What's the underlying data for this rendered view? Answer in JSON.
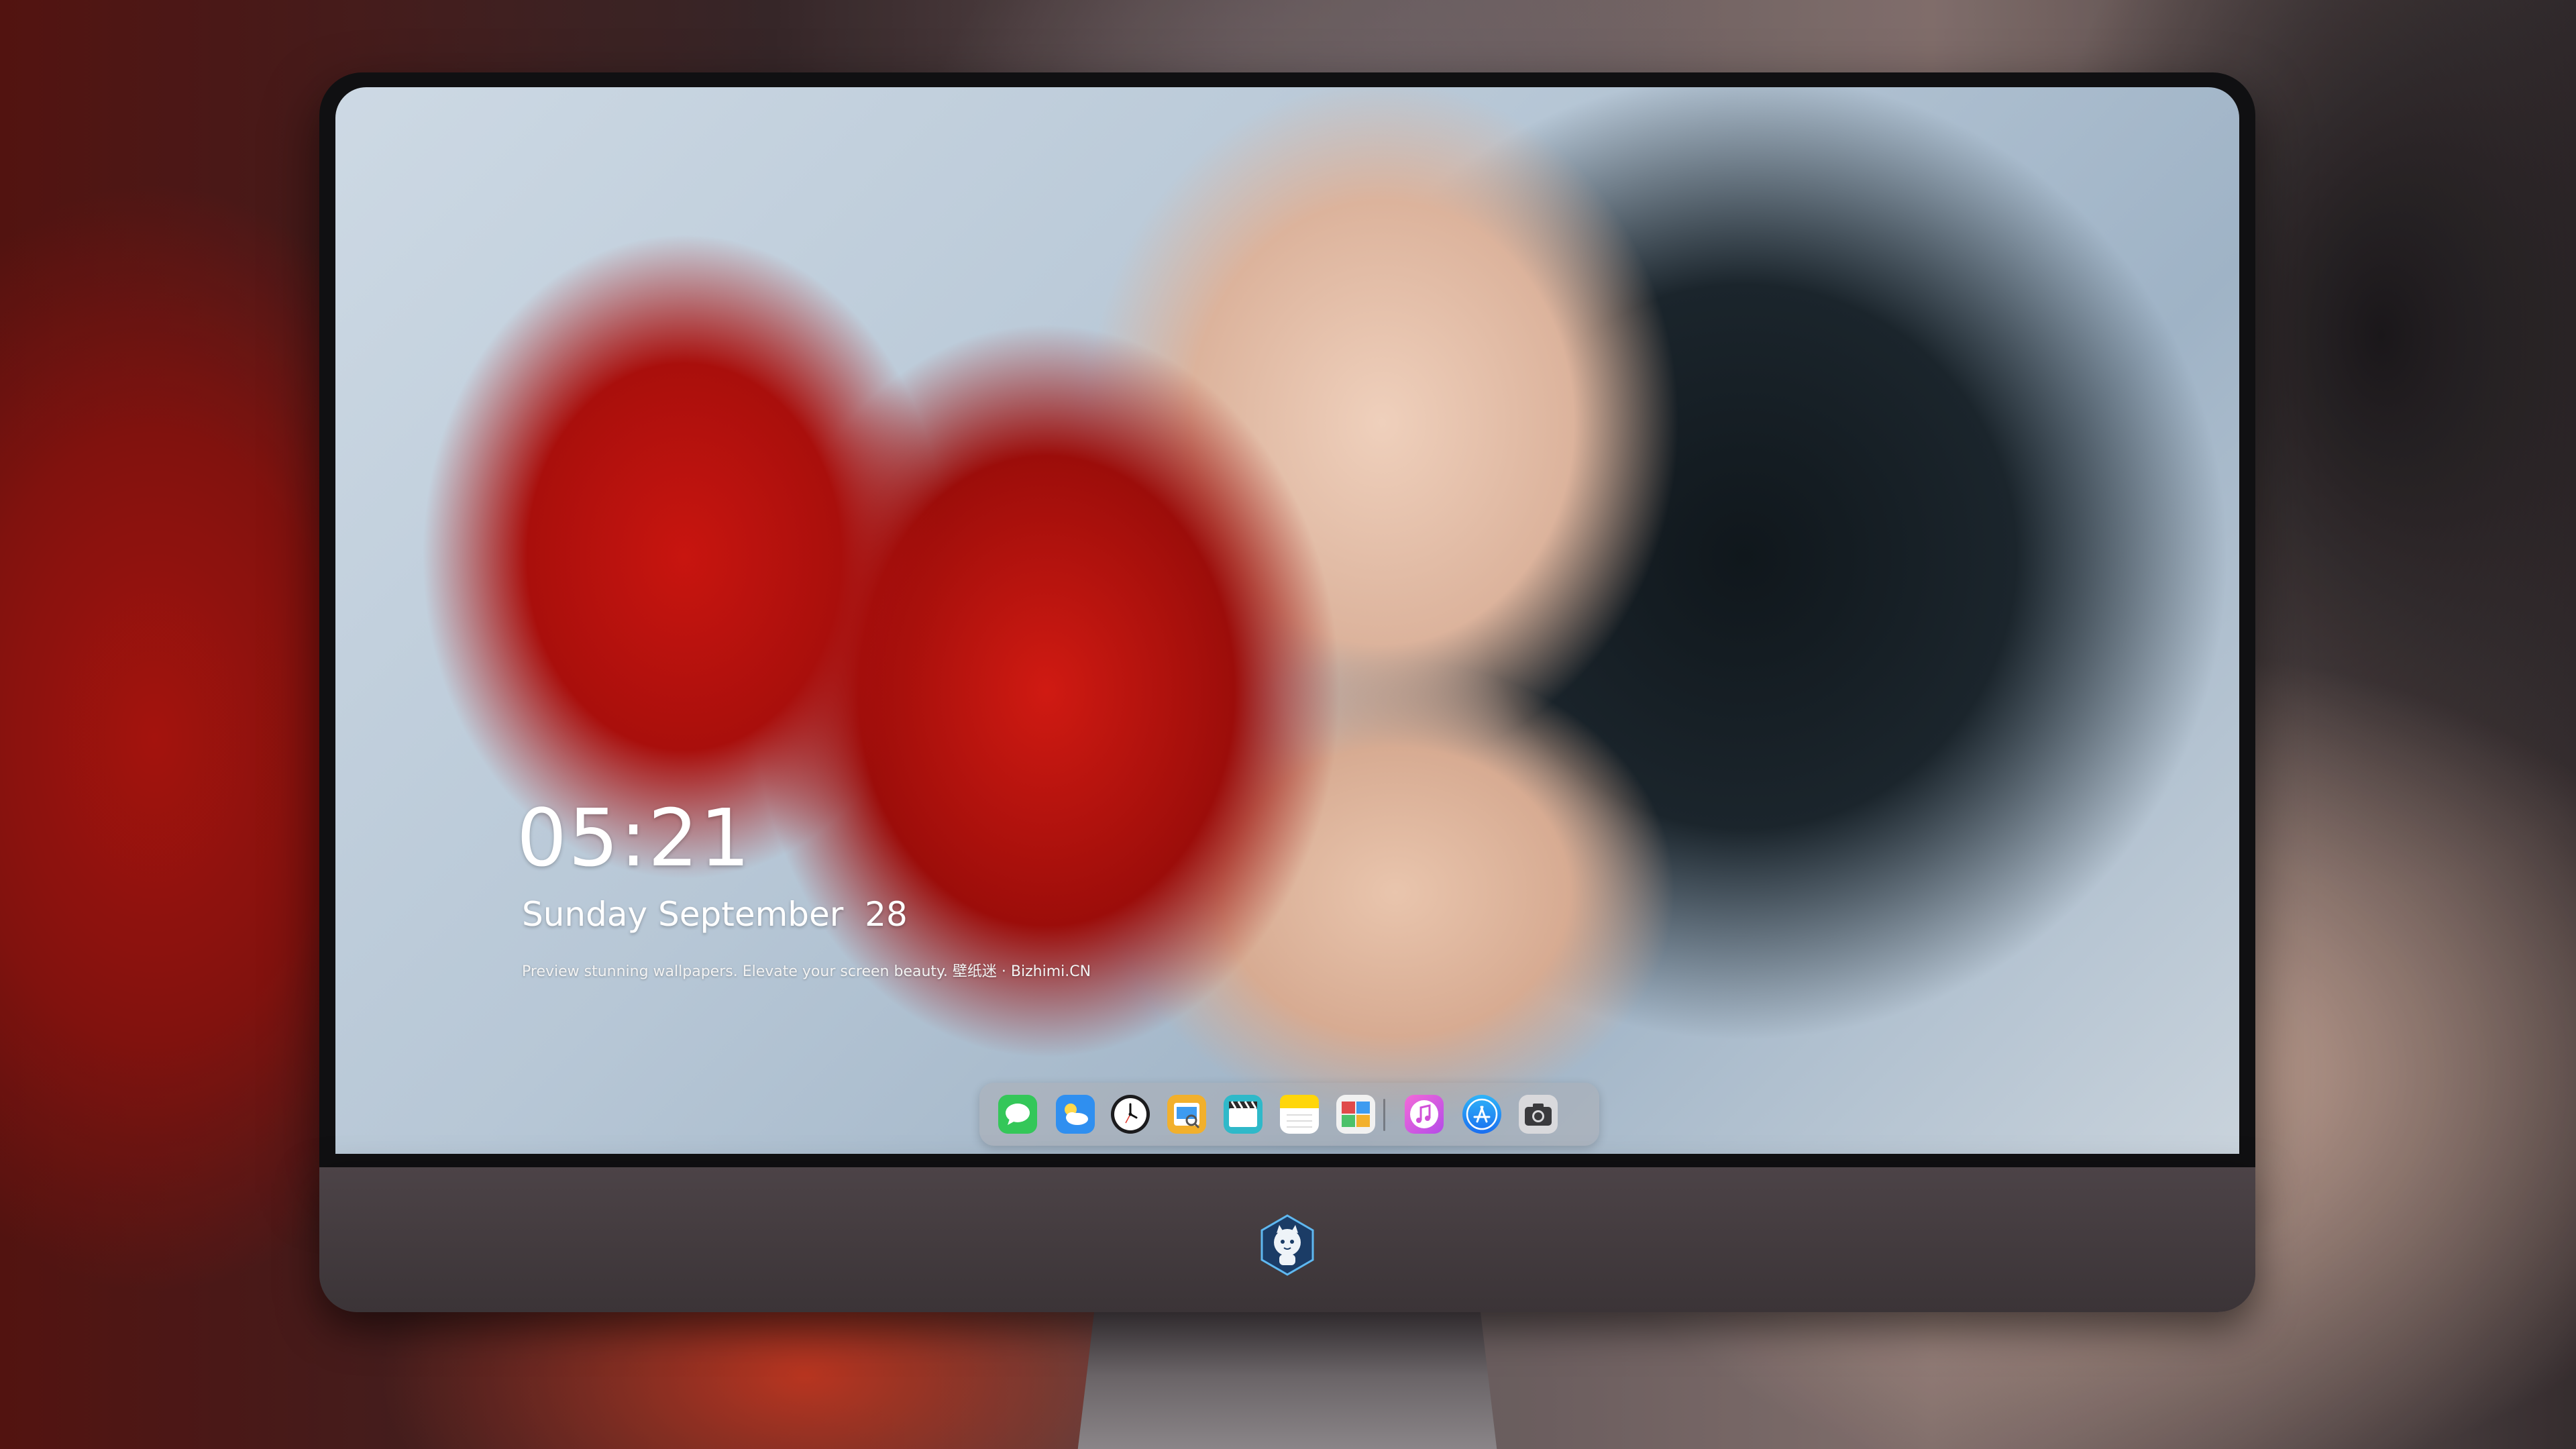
{
  "lockscreen": {
    "time": "05:21",
    "date": "Sunday September  28",
    "tagline": "Preview stunning wallpapers. Elevate your screen beauty. 壁纸迷 · Bizhimi.CN"
  },
  "dock": {
    "apps": [
      {
        "name": "messages-icon",
        "color": "#34c759"
      },
      {
        "name": "weather-icon",
        "color": "#2f8ff0"
      },
      {
        "name": "clock-icon",
        "color": "#ffffff"
      },
      {
        "name": "preview-icon",
        "color": "#f2b02c"
      },
      {
        "name": "video-icon",
        "color": "#2fb9c9"
      },
      {
        "name": "notes-icon",
        "color": "#ffd60a"
      },
      {
        "name": "photos-icon",
        "color": "#e04a4a"
      },
      {
        "name": "music-icon",
        "color": "#e35bd6"
      },
      {
        "name": "app-store-icon",
        "color": "#1e8bf5"
      },
      {
        "name": "camera-icon",
        "color": "#6d6d72"
      }
    ]
  },
  "monitor": {
    "chin_logo": "mascot-logo-icon"
  }
}
